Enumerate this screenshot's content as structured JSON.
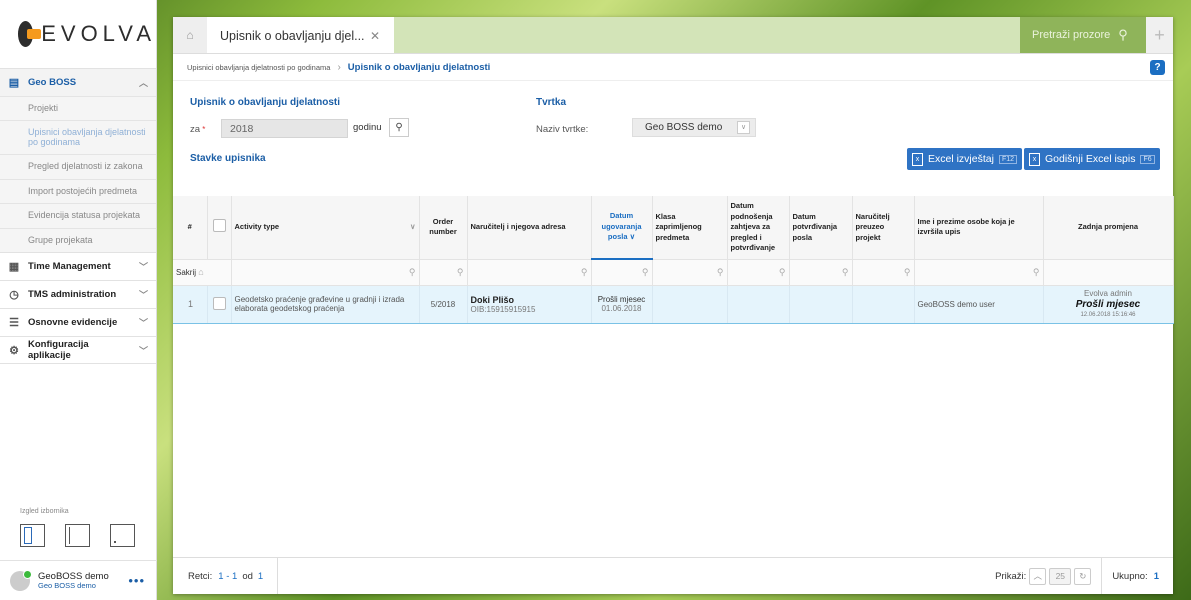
{
  "logo": {
    "text": "EVOLVA"
  },
  "sidebar": {
    "groups": [
      {
        "label": "Geo BOSS",
        "icon": "book-icon"
      },
      {
        "label": "Time Management",
        "icon": "calendar-icon"
      },
      {
        "label": "TMS administration",
        "icon": "clock-icon"
      },
      {
        "label": "Osnovne evidencije",
        "icon": "list-icon"
      },
      {
        "label": "Konfiguracija aplikacije",
        "icon": "gear-icon"
      }
    ],
    "sub_items": [
      "Projekti",
      "Upisnici obavljanja djelatnosti po godinama",
      "Pregled djelatnosti iz zakona",
      "Import postojećih predmeta",
      "Evidencija statusa projekata",
      "Grupe projekata"
    ],
    "layout_label": "Izgled izbornika",
    "user": {
      "name": "GeoBOSS demo",
      "org": "Geo BOSS demo"
    }
  },
  "tab": {
    "title": "Upisnik o obavljanju djel...",
    "search_placeholder": "Pretraži prozore"
  },
  "breadcrumb": {
    "parent": "Upisnici obavljanja djelatnosti po godinama",
    "current": "Upisnik o obavljanju djelatnosti"
  },
  "form": {
    "section1": "Upisnik o obavljanju djelatnosti",
    "za_label": "za",
    "year": "2018",
    "godinu": "godinu",
    "section2": "Tvrtka",
    "firm_label": "Naziv tvrtke:",
    "firm_value": "Geo BOSS demo",
    "items_title": "Stavke upisnika",
    "excel_btn": "Excel izvještaj",
    "excel_key": "F12",
    "annual_btn": "Godišnji Excel ispis",
    "annual_key": "F6"
  },
  "table": {
    "headers": [
      "#",
      "",
      "Activity type",
      "Order number",
      "Naručitelj i njegova adresa",
      "Datum ugovaranja posla",
      "Klasa zaprimljenog predmeta",
      "Datum podnošenja zahtjeva za pregled i potvrđivanje",
      "Datum potvrđivanja posla",
      "Naručitelj preuzeo projekt",
      "Ime i prezime osobe koja je izvršila upis",
      "Zadnja promjena"
    ],
    "filter_label": "Sakrij",
    "rows": [
      {
        "num": "1",
        "activity": "Geodetsko praćenje građevine u gradnji i izrada elaborata geodetskog praćenja",
        "order": "5/2018",
        "client_name": "Doki Plišo",
        "client_oib": "OIB:15915915915",
        "date_rel": "Prošli mjesec",
        "date": "01.06.2018",
        "klasa": "",
        "podnosenje": "",
        "potvrda": "",
        "preuzeo": "",
        "upisao": "GeoBOSS demo user",
        "changed_by": "Evolva admin",
        "changed_rel": "Prošli mjesec",
        "changed_ts": "12.06.2018 15:16:46"
      }
    ]
  },
  "footer": {
    "rows_label": "Retci:",
    "range": "1 - 1",
    "od": "od",
    "total_rows": "1",
    "show_label": "Prikaži:",
    "page_size": "25",
    "ukupno_label": "Ukupno:",
    "ukupno": "1"
  }
}
